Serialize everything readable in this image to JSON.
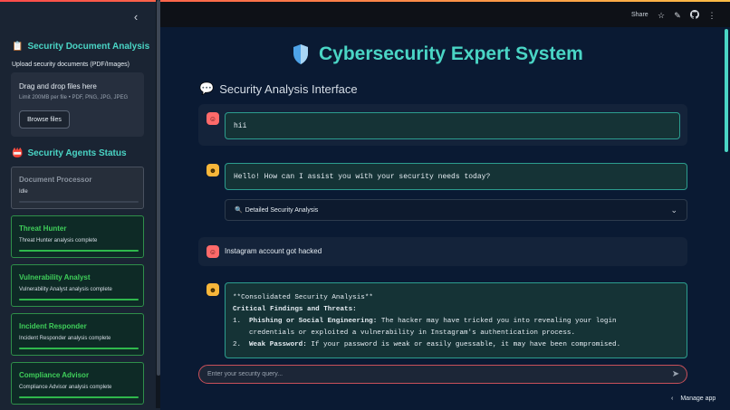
{
  "sidebar": {
    "collapse_icon": "‹",
    "doc_section": {
      "icon": "📋",
      "title": "Security Document Analysis"
    },
    "upload_label": "Upload security documents (PDF/Images)",
    "dropzone": {
      "title": "Drag and drop files here",
      "limit": "Limit 200MB per file • PDF, PNG, JPG, JPEG",
      "browse_label": "Browse files"
    },
    "agents_section": {
      "icon": "📛",
      "title": "Security Agents Status"
    },
    "agents": [
      {
        "name": "Document Processor",
        "status": "Idle",
        "progress": 0
      },
      {
        "name": "Threat Hunter",
        "status": "Threat Hunter analysis complete",
        "progress": 1
      },
      {
        "name": "Vulnerability Analyst",
        "status": "Vulnerability Analyst analysis complete",
        "progress": 1
      },
      {
        "name": "Incident Responder",
        "status": "Incident Responder analysis complete",
        "progress": 1
      },
      {
        "name": "Compliance Advisor",
        "status": "Compliance Advisor analysis complete",
        "progress": 1
      }
    ]
  },
  "header": {
    "share_label": "Share",
    "icons": [
      "star-icon",
      "edit-icon",
      "github-icon",
      "more-icon"
    ]
  },
  "main": {
    "title": "Cybersecurity Expert System",
    "subtitle_icon": "💬",
    "subtitle": "Security Analysis Interface",
    "messages": {
      "user1": "hii",
      "bot1": "Hello! How can I assist you with your security needs today?",
      "expander_icon": "🔍",
      "expander_label": "Detailed Security Analysis",
      "user2": "Instagram account got hacked",
      "bot2_header": "**Consolidated Security Analysis**",
      "bot2_sub": "Critical Findings and Threats:",
      "bot2_items": [
        {
          "num": "1.",
          "title": "Phishing or Social Engineering:",
          "line1": " The hacker may have tricked you into revealing your login",
          "line2": "credentials or exploited a vulnerability in Instagram's authentication process."
        },
        {
          "num": "2.",
          "title": "Weak Password:",
          "line1": " If your password is weak or easily guessable, it may have been compromised."
        }
      ]
    },
    "input_placeholder": "Enter your security query...",
    "manage_app": "Manage app"
  },
  "colors": {
    "accent": "#4ad5c5",
    "sidebar_bg": "#1a2433",
    "main_bg": "#0a1a33",
    "success": "#2fb84c",
    "user_avatar": "#ff6a6a",
    "bot_avatar": "#f8b73a"
  }
}
